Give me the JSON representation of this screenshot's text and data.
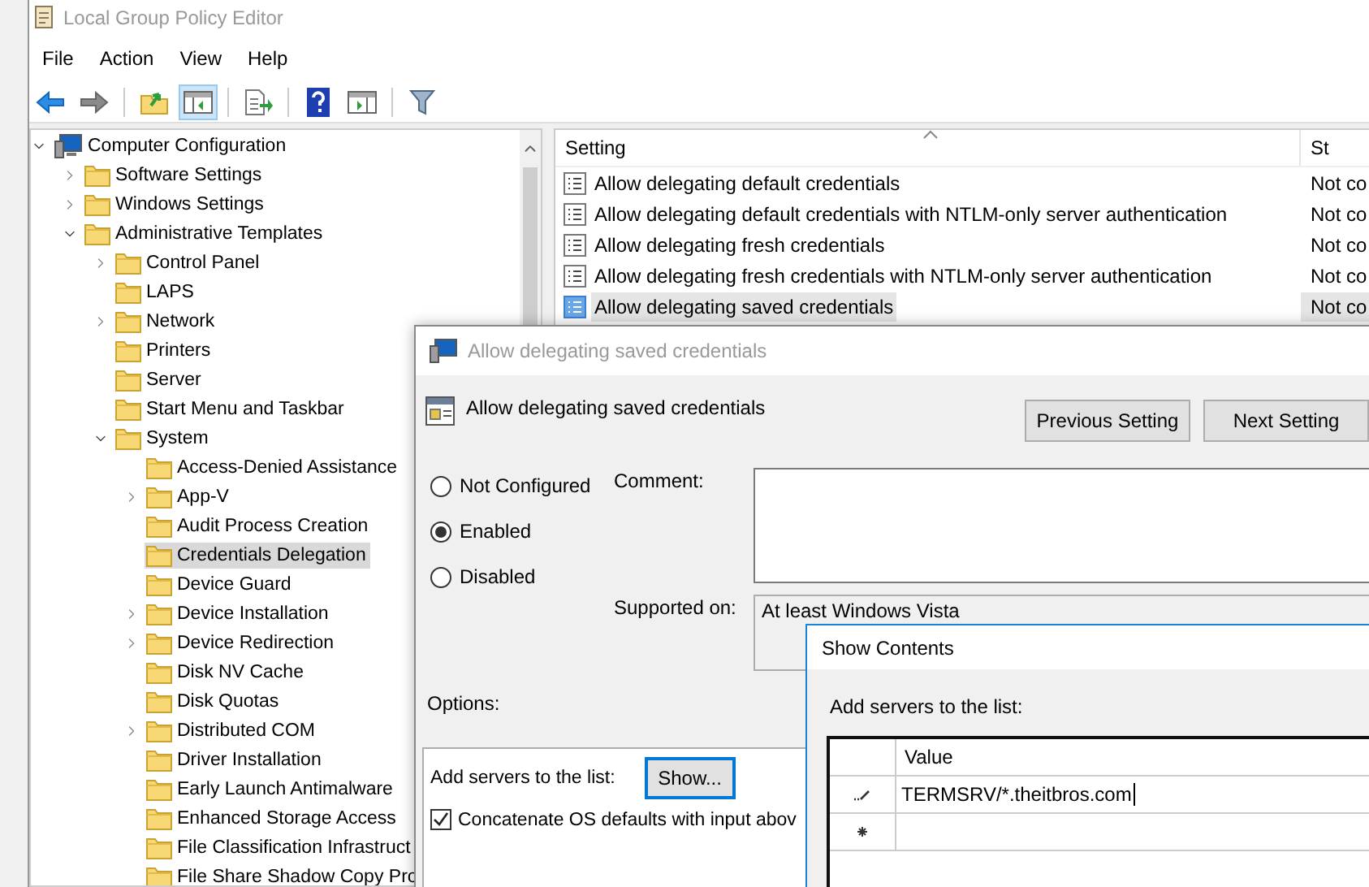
{
  "window": {
    "title": "Local Group Policy Editor"
  },
  "menu": [
    "File",
    "Action",
    "View",
    "Help"
  ],
  "toolbar": [
    {
      "kind": "back",
      "pressed": false
    },
    {
      "kind": "forward",
      "pressed": false
    },
    {
      "kind": "separator"
    },
    {
      "kind": "up",
      "pressed": false
    },
    {
      "kind": "tree",
      "pressed": true
    },
    {
      "kind": "separator"
    },
    {
      "kind": "export",
      "pressed": false
    },
    {
      "kind": "separator"
    },
    {
      "kind": "help",
      "pressed": false
    },
    {
      "kind": "pane",
      "pressed": false
    },
    {
      "kind": "separator"
    },
    {
      "kind": "filter",
      "pressed": false
    }
  ],
  "tree": [
    {
      "label": "Computer Configuration",
      "kind": "computer",
      "expanded": true,
      "selected": false,
      "children": [
        {
          "label": "Software Settings",
          "kind": "folder",
          "expanded": false,
          "selected": false
        },
        {
          "label": "Windows Settings",
          "kind": "folder",
          "expanded": false,
          "selected": false
        },
        {
          "label": "Administrative Templates",
          "kind": "folder",
          "expanded": true,
          "selected": false,
          "children": [
            {
              "label": "Control Panel",
              "kind": "folder",
              "expanded": false,
              "selected": false
            },
            {
              "label": "LAPS",
              "kind": "folder",
              "selected": false
            },
            {
              "label": "Network",
              "kind": "folder",
              "expanded": false,
              "selected": false
            },
            {
              "label": "Printers",
              "kind": "folder",
              "selected": false
            },
            {
              "label": "Server",
              "kind": "folder",
              "selected": false
            },
            {
              "label": "Start Menu and Taskbar",
              "kind": "folder",
              "selected": false
            },
            {
              "label": "System",
              "kind": "folder",
              "expanded": true,
              "selected": false,
              "children": [
                {
                  "label": "Access-Denied Assistance",
                  "kind": "folder",
                  "selected": false
                },
                {
                  "label": "App-V",
                  "kind": "folder",
                  "expanded": false,
                  "selected": false
                },
                {
                  "label": "Audit Process Creation",
                  "kind": "folder",
                  "selected": false
                },
                {
                  "label": "Credentials Delegation",
                  "kind": "folder",
                  "selected": true
                },
                {
                  "label": "Device Guard",
                  "kind": "folder",
                  "selected": false
                },
                {
                  "label": "Device Installation",
                  "kind": "folder",
                  "expanded": false,
                  "selected": false
                },
                {
                  "label": "Device Redirection",
                  "kind": "folder",
                  "expanded": false,
                  "selected": false
                },
                {
                  "label": "Disk NV Cache",
                  "kind": "folder",
                  "selected": false
                },
                {
                  "label": "Disk Quotas",
                  "kind": "folder",
                  "selected": false
                },
                {
                  "label": "Distributed COM",
                  "kind": "folder",
                  "expanded": false,
                  "selected": false
                },
                {
                  "label": "Driver Installation",
                  "kind": "folder",
                  "selected": false
                },
                {
                  "label": "Early Launch Antimalware",
                  "kind": "folder",
                  "selected": false
                },
                {
                  "label": "Enhanced Storage Access",
                  "kind": "folder",
                  "selected": false
                },
                {
                  "label": "File Classification Infrastruct",
                  "kind": "folder",
                  "selected": false
                },
                {
                  "label": "File Share Shadow Copy Pro",
                  "kind": "folder",
                  "selected": false
                }
              ]
            }
          ]
        }
      ]
    }
  ],
  "list": {
    "columns": [
      "Setting",
      "St"
    ],
    "rows": [
      {
        "setting": "Allow delegating default credentials",
        "state": "Not co",
        "selected": false
      },
      {
        "setting": "Allow delegating default credentials with NTLM-only server authentication",
        "state": "Not co",
        "selected": false
      },
      {
        "setting": "Allow delegating fresh credentials",
        "state": "Not co",
        "selected": false
      },
      {
        "setting": "Allow delegating fresh credentials with NTLM-only server authentication",
        "state": "Not co",
        "selected": false
      },
      {
        "setting": "Allow delegating saved credentials",
        "state": "Not co",
        "selected": true
      }
    ]
  },
  "dialog": {
    "title": "Allow delegating saved credentials",
    "heading": "Allow delegating saved credentials",
    "buttons": [
      "Previous Setting",
      "Next Setting"
    ],
    "options": [
      {
        "label": "Not Configured",
        "selected": false
      },
      {
        "label": "Enabled",
        "selected": true
      },
      {
        "label": "Disabled",
        "selected": false
      }
    ],
    "comment_label": "Comment:",
    "supported_label": "Supported on:",
    "supported_value": "At least Windows Vista",
    "options_label": "Options:",
    "add_label": "Add servers to the list:",
    "show_button": "Show...",
    "concatenate": {
      "label": "Concatenate OS defaults with input abov",
      "checked": true
    }
  },
  "show_contents": {
    "title": "Show Contents",
    "label": "Add servers to the list:",
    "column": "Value",
    "rows": [
      {
        "kind": "edit",
        "value": "TERMSRV/*.theitbros.com"
      },
      {
        "kind": "new"
      }
    ]
  }
}
